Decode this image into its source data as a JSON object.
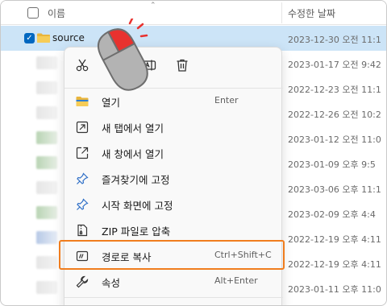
{
  "header": {
    "name_col": "이름",
    "date_col": "수정한 날짜"
  },
  "rows": [
    {
      "name": "source",
      "date": "2023-12-30 오전 11:1"
    },
    {
      "date": "2023-01-17 오전 9:42"
    },
    {
      "date": "2022-12-23 오전 11:1"
    },
    {
      "date": "2022-12-26 오전 10:2"
    },
    {
      "date": "2023-01-12 오전 11:0"
    },
    {
      "date": "2023-01-09 오후 9:5"
    },
    {
      "date": "2023-03-06 오후 11:1"
    },
    {
      "date": "2023-02-09 오후 4:4"
    },
    {
      "date": "2022-12-19 오후 4:11"
    },
    {
      "date": "2022-12-19 오후 4:11"
    },
    {
      "date": "2023-01-11 오후 11:0"
    }
  ],
  "toolbar": {
    "icons": [
      "cut-icon",
      "copy-icon",
      "rename-icon",
      "delete-icon"
    ]
  },
  "menu": {
    "items": [
      {
        "label": "열기",
        "shortcut": "Enter",
        "icon": "folder-icon"
      },
      {
        "label": "새 탭에서 열기",
        "shortcut": "",
        "icon": "open-in-new-tab-icon"
      },
      {
        "label": "새 창에서 열기",
        "shortcut": "",
        "icon": "open-in-new-window-icon"
      },
      {
        "label": "즐겨찾기에 고정",
        "shortcut": "",
        "icon": "pin-icon"
      },
      {
        "label": "시작 화면에 고정",
        "shortcut": "",
        "icon": "pin-icon"
      },
      {
        "label": "ZIP 파일로 압축",
        "shortcut": "",
        "icon": "zip-icon"
      },
      {
        "label": "경로로 복사",
        "shortcut": "Ctrl+Shift+C",
        "icon": "copy-path-icon"
      },
      {
        "label": "속성",
        "shortcut": "Alt+Enter",
        "icon": "wrench-icon"
      }
    ]
  },
  "colors": {
    "selection": "#cce4f7",
    "accent": "#0067c0",
    "highlight": "#f07d1e",
    "mouse_button": "#e8322f"
  }
}
